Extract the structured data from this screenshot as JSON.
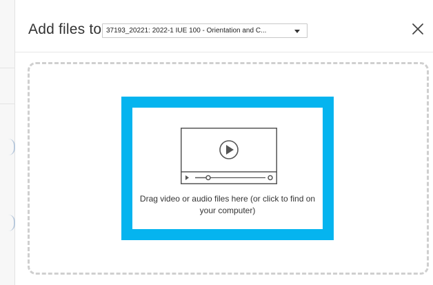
{
  "dialog": {
    "title": "Add files to",
    "folder_select": {
      "value": "37193_20221: 2022-1 IUE 100 - Orientation and C..."
    },
    "close_icon": "close-icon"
  },
  "dropzone": {
    "instructions": "Drag video or audio files here (or click to find on your computer)",
    "icon": "video-player-icon",
    "accent_color": "#05b4ef",
    "dashed_border_color": "#cfcfcf"
  }
}
